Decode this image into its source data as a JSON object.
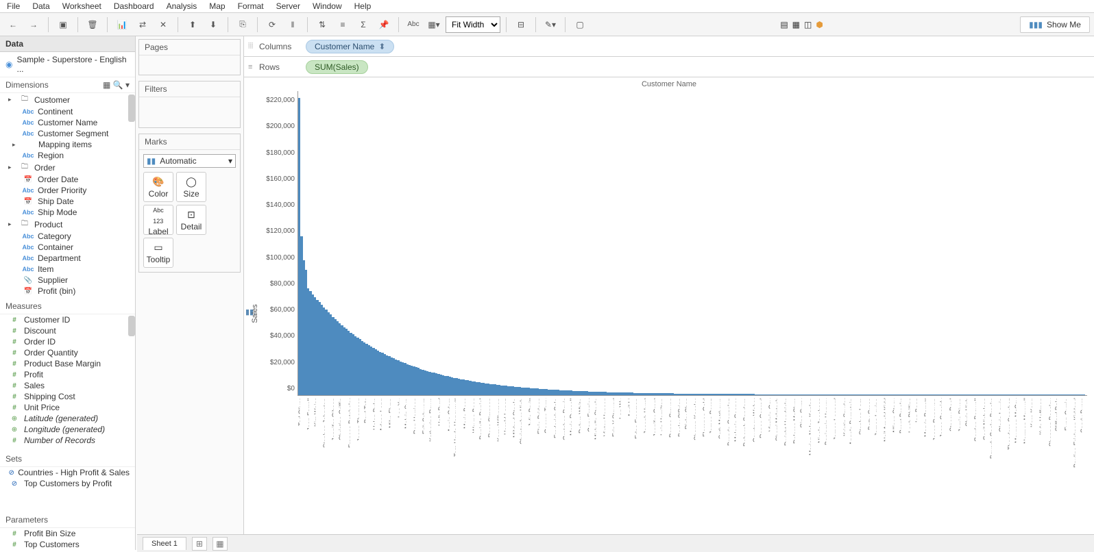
{
  "menu": [
    "File",
    "Data",
    "Worksheet",
    "Dashboard",
    "Analysis",
    "Map",
    "Format",
    "Server",
    "Window",
    "Help"
  ],
  "toolbar": {
    "fit_label": "Fit Width",
    "showme_label": "Show Me"
  },
  "data_panel": {
    "title": "Data",
    "datasource": "Sample - Superstore - English ...",
    "dimensions_label": "Dimensions",
    "measures_label": "Measures",
    "sets_label": "Sets",
    "parameters_label": "Parameters",
    "dim_groups": [
      {
        "name": "Customer",
        "items": [
          {
            "ico": "abc",
            "label": "Continent"
          },
          {
            "ico": "abc",
            "label": "Customer Name"
          },
          {
            "ico": "abc",
            "label": "Customer Segment"
          },
          {
            "ico": "caret",
            "label": "Mapping items"
          },
          {
            "ico": "abc",
            "label": "Region"
          }
        ]
      },
      {
        "name": "Order",
        "items": [
          {
            "ico": "date",
            "label": "Order Date"
          },
          {
            "ico": "abc",
            "label": "Order Priority"
          },
          {
            "ico": "date",
            "label": "Ship Date"
          },
          {
            "ico": "abc",
            "label": "Ship Mode"
          }
        ]
      },
      {
        "name": "Product",
        "items": [
          {
            "ico": "abc",
            "label": "Category"
          },
          {
            "ico": "abc",
            "label": "Container"
          },
          {
            "ico": "abc",
            "label": "Department"
          },
          {
            "ico": "abc",
            "label": "Item"
          },
          {
            "ico": "clip",
            "label": "Supplier"
          },
          {
            "ico": "date",
            "label": "Profit (bin)"
          }
        ]
      }
    ],
    "measures": [
      {
        "ico": "hash",
        "label": "Customer ID"
      },
      {
        "ico": "hash",
        "label": "Discount"
      },
      {
        "ico": "hash",
        "label": "Order ID"
      },
      {
        "ico": "hash",
        "label": "Order Quantity"
      },
      {
        "ico": "hash",
        "label": "Product Base Margin"
      },
      {
        "ico": "hash",
        "label": "Profit"
      },
      {
        "ico": "hash",
        "label": "Sales"
      },
      {
        "ico": "hash",
        "label": "Shipping Cost"
      },
      {
        "ico": "hash",
        "label": "Unit Price"
      },
      {
        "ico": "globe",
        "label": "Latitude (generated)",
        "italic": true
      },
      {
        "ico": "globe",
        "label": "Longitude (generated)",
        "italic": true
      },
      {
        "ico": "hash",
        "label": "Number of Records",
        "italic": true
      }
    ],
    "sets": [
      {
        "label": "Countries - High Profit & Sales"
      },
      {
        "label": "Top Customers by Profit"
      }
    ],
    "parameters": [
      {
        "label": "Profit Bin Size"
      },
      {
        "label": "Top Customers"
      }
    ]
  },
  "cards": {
    "pages": "Pages",
    "filters": "Filters",
    "marks": "Marks",
    "marks_type": "Automatic",
    "buttons": [
      "Color",
      "Size",
      "Label",
      "Detail",
      "Tooltip"
    ]
  },
  "shelves": {
    "columns_label": "Columns",
    "rows_label": "Rows",
    "columns_pill": "Customer Name",
    "rows_pill": "SUM(Sales)"
  },
  "sheet_tab": "Sheet 1",
  "chart_data": {
    "type": "bar",
    "title": "Customer Name",
    "ylabel": "Sales",
    "ylim": [
      0,
      230000
    ],
    "y_ticks": [
      "$0",
      "$20,000",
      "$40,000",
      "$60,000",
      "$80,000",
      "$100,000",
      "$120,000",
      "$140,000",
      "$160,000",
      "$180,000",
      "$200,000",
      "$220,000"
    ],
    "visible_labels": [
      "Ted Oliver",
      "Joan Farrell",
      "Kim Weiss",
      "Stephen Johnston",
      "Jennifer Gibson",
      "Christina Griffin",
      "Frances Batchelor",
      "Joann Thomson",
      "Paul Tate",
      "Helen Duke",
      "Arlene Long",
      "Mike Flynn",
      "Lee Xu",
      "Melvin Sun",
      "Ron Harrison",
      "Erik Schwarz",
      "Katharine Rowe",
      "Holly Byrd",
      "Annie Odom",
      "Tom Hoyle Honeycutt",
      "Marie Bass",
      "Wayne Bean",
      "Danielle Daniel",
      "Ross Simpson",
      "Kerry Wilkerson",
      "Harold Lopez",
      "Mildred Steele",
      "Christopher High",
      "Julie Pruitt",
      "Elsie Pridgen",
      "George Terry",
      "Frederick Cole",
      "Gretchen Davis",
      "Maria Russell",
      "Robyn White",
      "Gary Frazier",
      "Michelle Steele",
      "Victor Hansen",
      "Erin Y Stewart",
      "Lan Wu",
      "April Li",
      "Edna Freeman",
      "Joseph Hurst",
      "Jennifer Grant",
      "Lois Hamilton",
      "Donna Craven",
      "Becky O'Brien",
      "Ricky Chen",
      "Sharon Kessler",
      "Florence Gold",
      "James Perez",
      "Seth Matthews",
      "Brenda Gonzalez",
      "Melanie Cooper",
      "Deborah Sanders",
      "Courtney Weber",
      "Renee Conrad",
      "Virginia Gay",
      "Sherri McIntosh",
      "Dwight Hendricks",
      "Dolores McClure",
      "Gina Curry",
      "Marion Nolan Kaplan",
      "Nicole Jacobson",
      "Benjamin Harvey",
      "James Leonard",
      "Kristin Snyder",
      "Angela Bernstein",
      "Stephen Lam",
      "Betty Cross",
      "James Levine",
      "Neil Arnold Kidd",
      "Allison Stacy",
      "Brent Brooks",
      "Leah Phillips",
      "Ian Bean",
      "Marvin Parrott",
      "Jason Donovan",
      "Jesse Cassidy",
      "Stacey Deal",
      "Jamie Dixon",
      "Chris High",
      "Gordon Boswell",
      "Cecil Nicholson",
      "Beverly Cooke Brooks",
      "Gloria Lewis",
      "Theodore Sanchez",
      "Maureen McCoy",
      "Norman Maxwell",
      "Kara Kang",
      "Kyle Hoffman",
      "Shannon Beasley",
      "Clifford Dale",
      "Evan Currie",
      "Pauline Erickson Kirkland",
      "Sandy Byers"
    ],
    "series": [
      {
        "name": "Sales",
        "color": "#4e8bbf"
      }
    ]
  }
}
